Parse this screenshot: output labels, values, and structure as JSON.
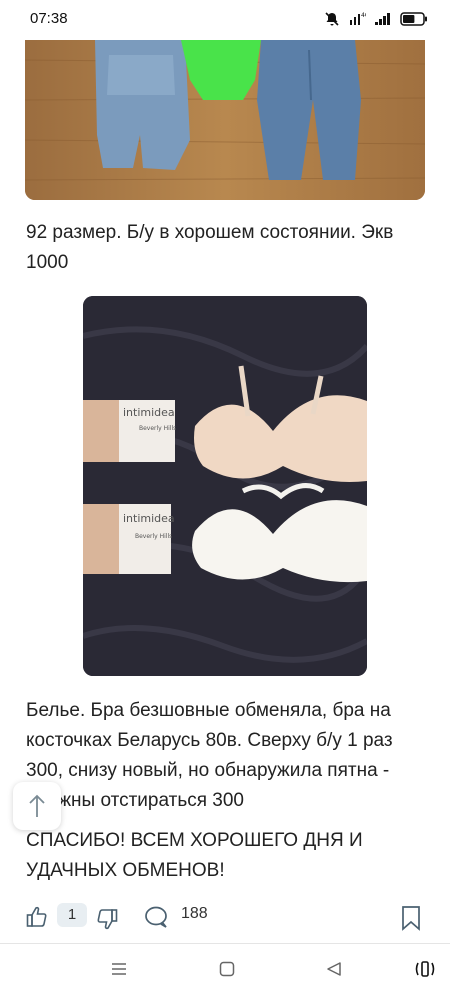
{
  "status_bar": {
    "time": "07:38",
    "battery_level": 0.6,
    "icons": [
      "mute-icon",
      "wifi-icon",
      "signal-icon",
      "battery-icon"
    ]
  },
  "post": {
    "image1": {
      "description": "",
      "background": "#a87a4a"
    },
    "text1": "92 размер. Б/у в хорошем состоянии. Экв 1000",
    "image2": {
      "package_brand": "intimidea",
      "package_line": "Beverly Hills"
    },
    "text2": "Белье. Бра безшовные обменяла, бра на косточках Беларусь 80в. Сверху б/у 1 раз 300, снизу новый, но обнаружила пятна - должны отстираться 300",
    "text3": "СПАСИБО! ВСЕМ ХОРОШЕГО ДНЯ И УДАЧНЫХ ОБМЕНОВ!"
  },
  "actions": {
    "like_count": "1",
    "comment_count": "188"
  },
  "nav": {
    "items": [
      "menu-icon",
      "home-icon",
      "back-icon",
      "accessibility-icon"
    ]
  }
}
